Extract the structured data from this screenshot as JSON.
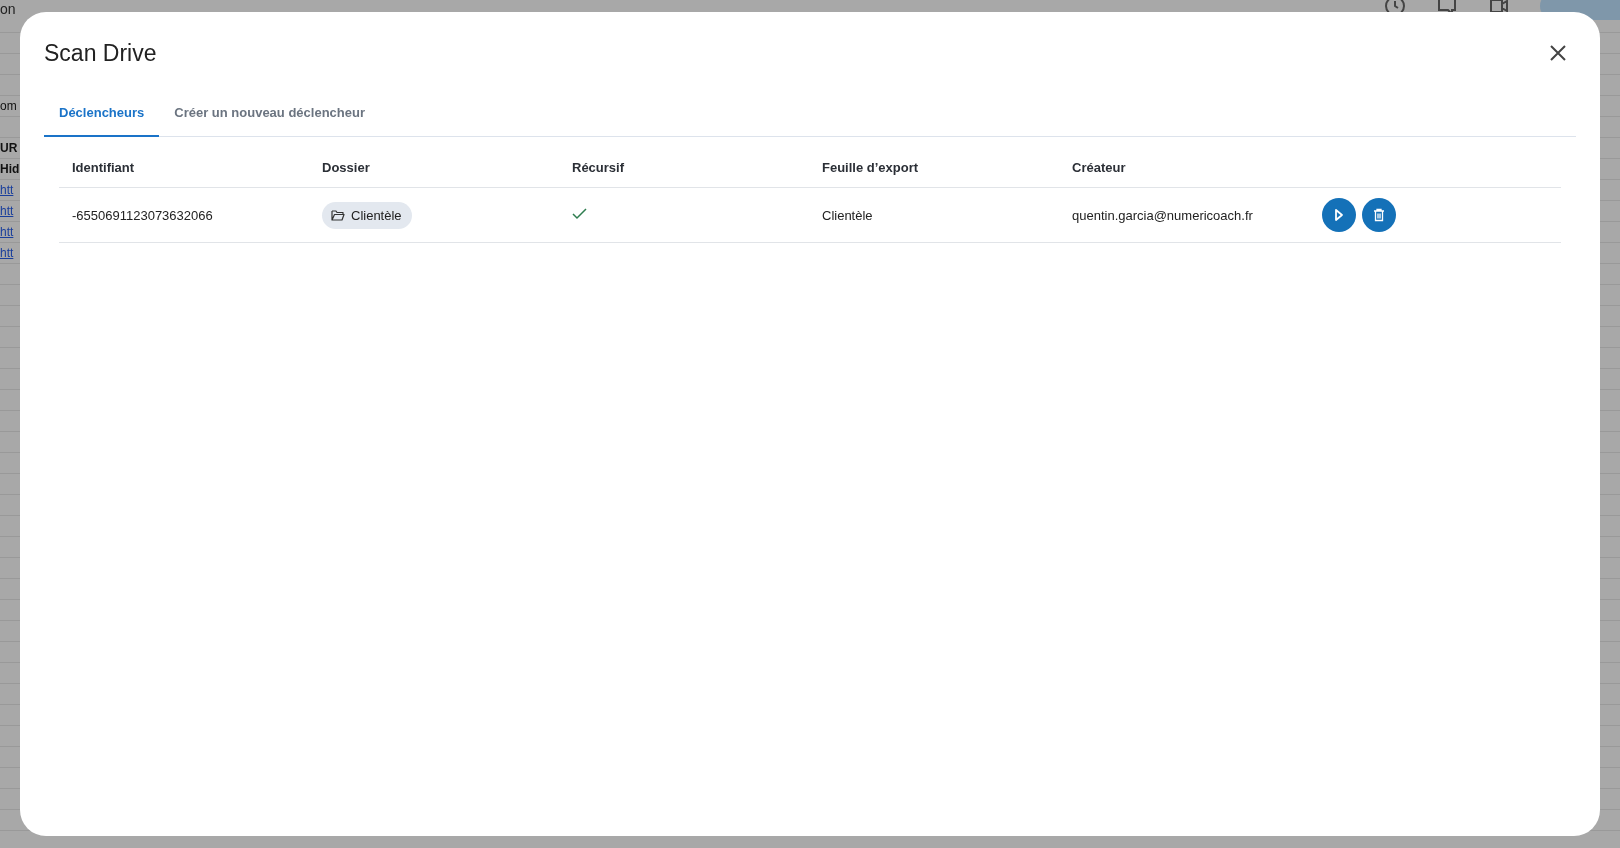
{
  "background": {
    "menu": [
      "on"
    ],
    "cells": [
      {
        "text": "om",
        "kind": "text"
      },
      {
        "text": "UR",
        "kind": "bold"
      },
      {
        "text": "Hid",
        "kind": "bold"
      },
      {
        "text": "htt",
        "kind": "link"
      },
      {
        "text": "htt",
        "kind": "link"
      },
      {
        "text": "htt",
        "kind": "link"
      },
      {
        "text": "htt",
        "kind": "link"
      }
    ]
  },
  "dialog": {
    "title": "Scan Drive",
    "tabs": [
      {
        "label": "Déclencheurs",
        "selected": true
      },
      {
        "label": "Créer un nouveau déclencheur",
        "selected": false
      }
    ],
    "table": {
      "columns": [
        "Identifiant",
        "Dossier",
        "Récursif",
        "Feuille d’export",
        "Créateur"
      ],
      "rows": [
        {
          "id": "-6550691123073632066",
          "folder": "Clientèle",
          "recursive": true,
          "sheet": "Clientèle",
          "creator": "quentin.garcia@numericoach.fr"
        }
      ]
    }
  }
}
